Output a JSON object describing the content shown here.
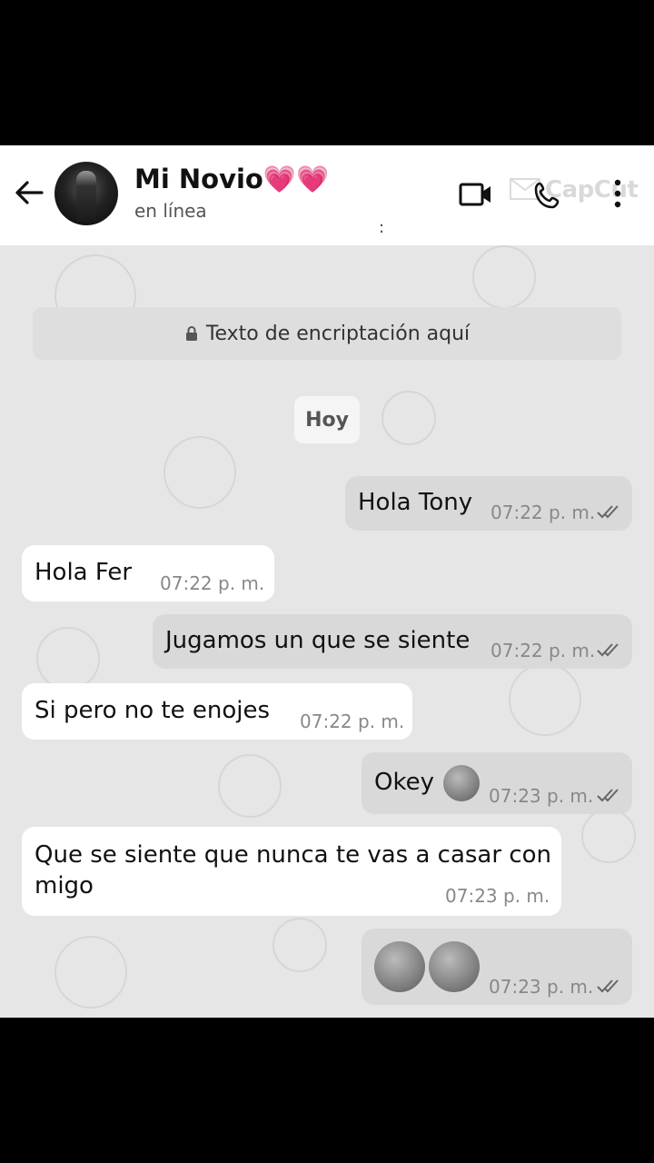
{
  "header": {
    "contact_name": "Mi Novio💗💗",
    "status": "en línea",
    "colon": ":",
    "watermark": "CapCut"
  },
  "chat": {
    "encryption_notice": "Texto de encriptación aquí",
    "date_chip": "Hoy",
    "messages": [
      {
        "direction": "out",
        "text": "Hola Tony",
        "time": "07:22 p. m."
      },
      {
        "direction": "in",
        "text": "Hola Fer",
        "time": "07:22 p. m."
      },
      {
        "direction": "out",
        "text": "Jugamos un que se siente",
        "time": "07:22 p. m."
      },
      {
        "direction": "in",
        "text": "Si pero no te enojes",
        "time": "07:22 p. m."
      },
      {
        "direction": "out",
        "text": "Okey",
        "emoji": "kissing-face-wink",
        "time": "07:23 p. m."
      },
      {
        "direction": "in",
        "text": "Que se siente que nunca te vas a casar con",
        "text2": "migo",
        "time": "07:23 p. m."
      },
      {
        "direction": "out",
        "emoji": [
          "sleepy-face",
          "sad-tear-face"
        ],
        "time": "07:23 p. m."
      }
    ]
  }
}
